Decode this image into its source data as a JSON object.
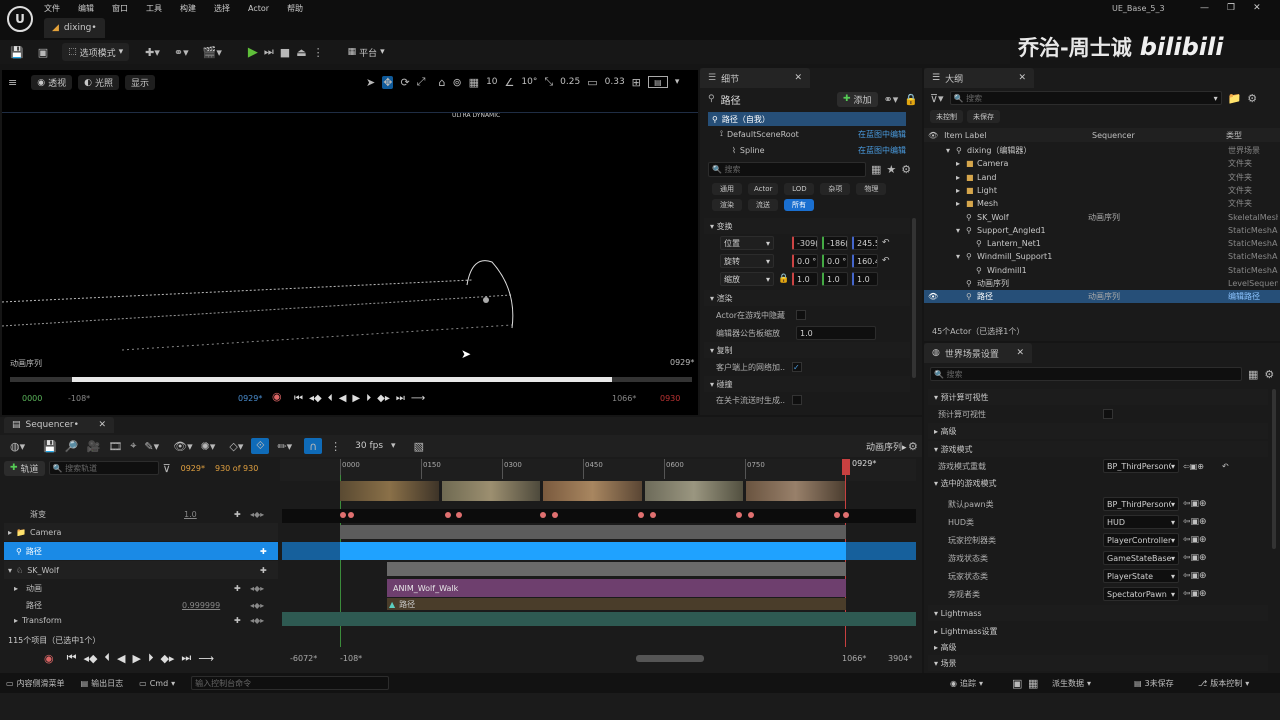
{
  "menu": {
    "items": [
      "文件",
      "编辑",
      "窗口",
      "工具",
      "构建",
      "选择",
      "Actor",
      "帮助"
    ],
    "project": "UE_Base_5_3",
    "tab": "dixing•"
  },
  "watermark": {
    "name": "乔治-周士诚",
    "brand": "bilibili"
  },
  "toolbar": {
    "mode": "选项模式",
    "platform": "平台"
  },
  "viewport": {
    "perspective": "透视",
    "lit": "光照",
    "show": "显示",
    "grid": "10",
    "angle": "10°",
    "scale": "0.25",
    "cam": "0.33",
    "seq_label": "动画序列",
    "frame_right": "0929*",
    "start": "0000",
    "neg": "-108*",
    "cur": "0929*",
    "end1": "1066*",
    "end2": "0930",
    "overlay": "ULTRA DYNAMIC"
  },
  "details": {
    "tab": "细节",
    "actor": "路径",
    "add": "添加",
    "self": "路径（自我）",
    "root": "DefaultSceneRoot",
    "spline": "Spline",
    "edit_bp": "在蓝图中编辑",
    "search": "搜索",
    "filters": [
      "通用",
      "Actor",
      "LOD",
      "杂项",
      "物理"
    ],
    "filters2": [
      "渲染",
      "流送",
      "所有"
    ],
    "transform": "变换",
    "loc": "位置",
    "rot": "旋转",
    "scale": "缩放",
    "loc_vals": [
      "-309(",
      "-186(",
      "245.5"
    ],
    "rot_vals": [
      "0.0 °",
      "0.0 °",
      "160.4"
    ],
    "scale_vals": [
      "1.0",
      "1.0",
      "1.0"
    ],
    "render": "渲染",
    "hide_game": "Actor在游戏中隐藏",
    "billboard": "编辑器公告板缩放",
    "billboard_val": "1.0",
    "replication": "复制",
    "net_load": "客户端上的网络加...",
    "collision": "碰撞",
    "gen_overlap": "在关卡流送时生成..."
  },
  "outliner": {
    "tab": "大纲",
    "search": "搜索",
    "unctrl": "未控制",
    "unsaved": "未保存",
    "col_label": "Item Label",
    "col_seq": "Sequencer",
    "col_type": "类型",
    "rows": [
      {
        "label": "dixing（编辑器）",
        "seq": "",
        "type": "世界场景",
        "indent": 0,
        "icon": "▾"
      },
      {
        "label": "Camera",
        "seq": "",
        "type": "文件夹",
        "indent": 1,
        "icon": "▸"
      },
      {
        "label": "Land",
        "seq": "",
        "type": "文件夹",
        "indent": 1,
        "icon": "▸"
      },
      {
        "label": "Light",
        "seq": "",
        "type": "文件夹",
        "indent": 1,
        "icon": "▸"
      },
      {
        "label": "Mesh",
        "seq": "",
        "type": "文件夹",
        "indent": 1,
        "icon": "▸"
      },
      {
        "label": "SK_Wolf",
        "seq": "动画序列",
        "type": "SkeletalMesh",
        "indent": 1,
        "icon": ""
      },
      {
        "label": "Support_Angled1",
        "seq": "",
        "type": "StaticMeshA",
        "indent": 1,
        "icon": "▾"
      },
      {
        "label": "Lantern_Net1",
        "seq": "",
        "type": "StaticMeshA",
        "indent": 2,
        "icon": ""
      },
      {
        "label": "Windmill_Support1",
        "seq": "",
        "type": "StaticMeshA",
        "indent": 1,
        "icon": "▾"
      },
      {
        "label": "Windmill1",
        "seq": "",
        "type": "StaticMeshA",
        "indent": 2,
        "icon": ""
      },
      {
        "label": "动画序列",
        "seq": "",
        "type": "LevelSequen",
        "indent": 1,
        "icon": ""
      },
      {
        "label": "路径",
        "seq": "动画序列",
        "type": "编辑路径",
        "indent": 1,
        "icon": ""
      }
    ],
    "count": "45个Actor（已选择1个）"
  },
  "world": {
    "tab": "世界场景设置",
    "search": "搜索",
    "precompute": "预计算可视性",
    "precompute_item": "预计算可视性",
    "advanced": "高级",
    "gamemode": "游戏模式",
    "gm_override": "游戏模式重载",
    "gm_val": "BP_ThirdPersonGa",
    "selected_gm": "选中的游戏模式",
    "pawn": "默认pawn类",
    "pawn_val": "BP_ThirdPersonCh",
    "hud": "HUD类",
    "hud_val": "HUD",
    "pc": "玩家控制器类",
    "pc_val": "PlayerController",
    "gs": "游戏状态类",
    "gs_val": "GameStateBase",
    "ps": "玩家状态类",
    "ps_val": "PlayerState",
    "spec": "旁观者类",
    "spec_val": "SpectatorPawn",
    "lightmass": "Lightmass",
    "lm_settings": "Lightmass设置",
    "advanced2": "高级",
    "scene": "场景"
  },
  "sequencer": {
    "tab": "Sequencer•",
    "fps": "30 fps",
    "seq_name": "动画序列▸",
    "add_track": "轨道",
    "search": "搜索轨道",
    "frame": "0929*",
    "of": "930 of 930",
    "ticks": [
      "0000",
      "0150",
      "0300",
      "0450",
      "0600",
      "0750",
      "0929*"
    ],
    "tracks": [
      "渐变",
      "Camera",
      "路径",
      "SK_Wolf",
      "动画",
      "路径",
      "Transform"
    ],
    "fade_val": "1.0",
    "path_val": "0.999999",
    "anim_clip": "ANIM_Wolf_Walk",
    "path_clip": "路径",
    "count": "115个项目（已选中1个）",
    "bot": [
      "-6072*",
      "-108*",
      "1066*",
      "3904*"
    ]
  },
  "status": {
    "drawer": "内容侧滑菜单",
    "log": "输出日志",
    "cmd": "Cmd",
    "cmd_placeholder": "输入控制台命令",
    "trace": "追踪",
    "derived": "派生数据",
    "unsaved": "3未保存",
    "source": "版本控制"
  }
}
